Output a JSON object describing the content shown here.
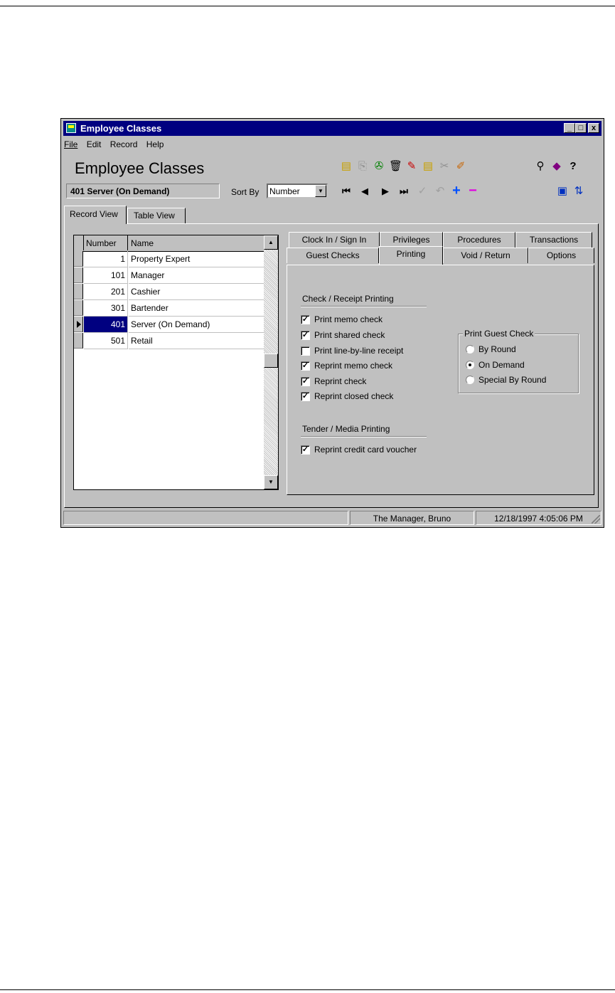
{
  "window": {
    "title": "Employee Classes",
    "heading": "Employee Classes",
    "current_record": "401 Server (On Demand)",
    "controls": [
      "_",
      "□",
      "x"
    ]
  },
  "menu": {
    "file": "File",
    "edit": "Edit",
    "record": "Record",
    "help": "Help"
  },
  "sort": {
    "label": "Sort By",
    "value": "Number"
  },
  "toolbar": {
    "icons": [
      "new-record-icon",
      "copy-record-icon",
      "paste-record-icon",
      "delete-icon",
      "edit-record-icon",
      "duplicate-record-icon",
      "cut-icon",
      "attach-icon",
      "find-icon",
      "book-icon",
      "help-pointer-icon",
      "first-icon",
      "previous-icon",
      "next-icon",
      "last-icon",
      "confirm-icon",
      "undo-icon",
      "add-icon",
      "remove-icon",
      "screen-icon",
      "refresh-icon"
    ]
  },
  "view_tabs": [
    "Record View",
    "Table View"
  ],
  "grid": {
    "columns": [
      "Number",
      "Name"
    ],
    "rows": [
      {
        "number": "1",
        "name": "Property Expert"
      },
      {
        "number": "101",
        "name": "Manager"
      },
      {
        "number": "201",
        "name": "Cashier"
      },
      {
        "number": "301",
        "name": "Bartender"
      },
      {
        "number": "401",
        "name": "Server (On Demand)"
      },
      {
        "number": "501",
        "name": "Retail"
      }
    ],
    "selected_index": 4
  },
  "property_tabs": {
    "back_row": [
      "Clock In / Sign In",
      "Privileges",
      "Procedures",
      "Transactions"
    ],
    "front_row": [
      "Guest Checks",
      "Printing",
      "Void / Return",
      "Options"
    ],
    "active": "Printing"
  },
  "printing": {
    "check_group": "Check / Receipt Printing",
    "check_options": [
      {
        "label": "Print memo check",
        "checked": true
      },
      {
        "label": "Print shared check",
        "checked": true
      },
      {
        "label": "Print line-by-line receipt",
        "checked": false
      },
      {
        "label": "Reprint memo check",
        "checked": true
      },
      {
        "label": "Reprint check",
        "checked": true
      },
      {
        "label": "Reprint closed check",
        "checked": true
      }
    ],
    "tender_group": "Tender / Media Printing",
    "tender_options": [
      {
        "label": "Reprint credit card voucher",
        "checked": true
      }
    ],
    "guest_check_group": "Print Guest Check",
    "guest_check_options": [
      {
        "label": "By Round",
        "selected": false
      },
      {
        "label": "On Demand",
        "selected": true
      },
      {
        "label": "Special By Round",
        "selected": false
      }
    ]
  },
  "status": {
    "user": "The Manager, Bruno",
    "datetime": "12/18/1997 4:05:06 PM"
  }
}
